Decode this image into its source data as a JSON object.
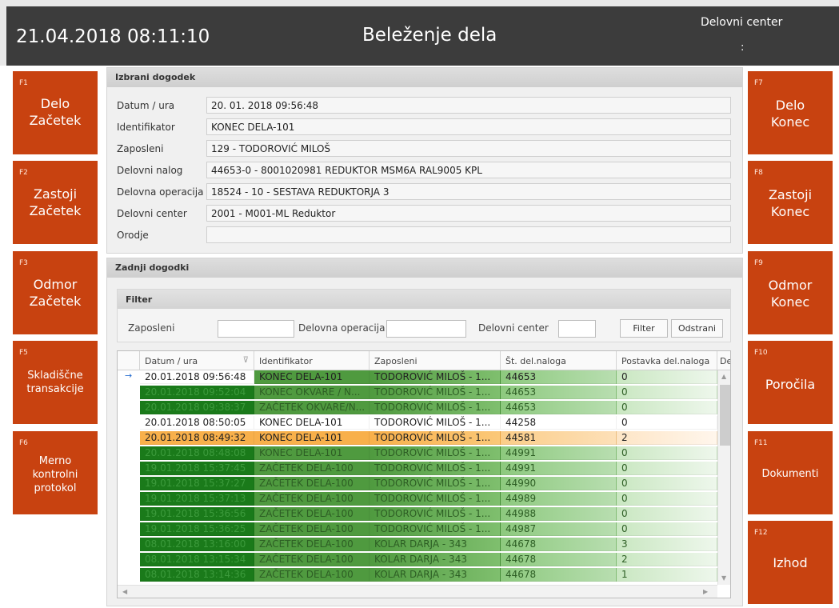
{
  "header": {
    "datetime": "21.04.2018 08:11:10",
    "title": "Beleženje dela",
    "work_center_label": "Delovni center",
    "work_center_value": ":"
  },
  "left_buttons": [
    {
      "key": "F1",
      "label": "Delo\nZačetek",
      "size": "big"
    },
    {
      "key": "F2",
      "label": "Zastoji\nZačetek",
      "size": "big"
    },
    {
      "key": "F3",
      "label": "Odmor\nZačetek",
      "size": "big"
    },
    {
      "key": "F5",
      "label": "Skladiščne\ntransakcije",
      "size": "small"
    },
    {
      "key": "F6",
      "label": "Merno\nkontrolni\nprotokol",
      "size": "small"
    }
  ],
  "right_buttons": [
    {
      "key": "F7",
      "label": "Delo\nKonec",
      "size": "big"
    },
    {
      "key": "F8",
      "label": "Zastoji\nKonec",
      "size": "big"
    },
    {
      "key": "F9",
      "label": "Odmor\nKonec",
      "size": "big"
    },
    {
      "key": "F10",
      "label": "Poročila",
      "size": "big"
    },
    {
      "key": "F11",
      "label": "Dokumenti",
      "size": "small"
    },
    {
      "key": "F12",
      "label": "Izhod",
      "size": "big"
    }
  ],
  "selected_event": {
    "title": "Izbrani dogodek",
    "fields": [
      {
        "label": "Datum / ura",
        "value": "20. 01. 2018 09:56:48"
      },
      {
        "label": "Identifikator",
        "value": "KONEC DELA-101"
      },
      {
        "label": "Zaposleni",
        "value": "129 - TODOROVIĆ MILOŠ"
      },
      {
        "label": "Delovni nalog",
        "value": "44653-0 - 8001020981 REDUKTOR MSM6A RAL9005 KPL"
      },
      {
        "label": "Delovna operacija",
        "value": "18524 - 10 - SESTAVA REDUKTORJA 3"
      },
      {
        "label": "Delovni center",
        "value": "2001 - M001-ML Reduktor"
      },
      {
        "label": "Orodje",
        "value": ""
      }
    ]
  },
  "recent_events": {
    "title": "Zadnji dogodki",
    "filter": {
      "title": "Filter",
      "employee_label": "Zaposleni",
      "operation_label": "Delovna operacija",
      "center_label": "Delovni center",
      "filter_button": "Filter",
      "clear_button": "Odstrani"
    },
    "columns": [
      "Datum / ura",
      "Identifikator",
      "Zaposleni",
      "Št. del.naloga",
      "Postavka del.naloga",
      "De"
    ],
    "row_marker": "→",
    "rows": [
      {
        "date": "20.01.2018 09:56:48",
        "id": "KONEC DELA-101",
        "emp": "TODOROVIĆ MILOŠ - 1...",
        "order": "44653",
        "item": "0",
        "style": "sel"
      },
      {
        "date": "20.01.2018 09:52:04",
        "id": "KONEC OKVARE / N...",
        "emp": "TODOROVIĆ MILOŠ - 1...",
        "order": "44653",
        "item": "0",
        "style": "green"
      },
      {
        "date": "20.01.2018 09:38:37",
        "id": "ZAČETEK OKVARE/N...",
        "emp": "TODOROVIĆ MILOŠ - 1...",
        "order": "44653",
        "item": "0",
        "style": "green"
      },
      {
        "date": "20.01.2018 08:50:05",
        "id": "KONEC DELA-101",
        "emp": "TODOROVIĆ MILOŠ - 1...",
        "order": "44258",
        "item": "0",
        "style": "white"
      },
      {
        "date": "20.01.2018 08:49:32",
        "id": "KONEC DELA-101",
        "emp": "TODOROVIĆ MILOŠ - 1...",
        "order": "44581",
        "item": "2",
        "style": "orange"
      },
      {
        "date": "20.01.2018 08:48:08",
        "id": "KONEC DELA-101",
        "emp": "TODOROVIĆ MILOŠ - 1...",
        "order": "44991",
        "item": "0",
        "style": "green"
      },
      {
        "date": "19.01.2018 15:37:45",
        "id": "ZAČETEK DELA-100",
        "emp": "TODOROVIĆ MILOŠ - 1...",
        "order": "44991",
        "item": "0",
        "style": "green"
      },
      {
        "date": "19.01.2018 15:37:27",
        "id": "ZAČETEK DELA-100",
        "emp": "TODOROVIĆ MILOŠ - 1...",
        "order": "44990",
        "item": "0",
        "style": "green"
      },
      {
        "date": "19.01.2018 15:37:13",
        "id": "ZAČETEK DELA-100",
        "emp": "TODOROVIĆ MILOŠ - 1...",
        "order": "44989",
        "item": "0",
        "style": "green"
      },
      {
        "date": "19.01.2018 15:36:56",
        "id": "ZAČETEK DELA-100",
        "emp": "TODOROVIĆ MILOŠ - 1...",
        "order": "44988",
        "item": "0",
        "style": "green"
      },
      {
        "date": "19.01.2018 15:36:25",
        "id": "ZAČETEK DELA-100",
        "emp": "TODOROVIĆ MILOŠ - 1...",
        "order": "44987",
        "item": "0",
        "style": "green"
      },
      {
        "date": "08.01.2018 13:16:00",
        "id": "ZAČETEK DELA-100",
        "emp": "KOLAR DARJA - 343",
        "order": "44678",
        "item": "3",
        "style": "green"
      },
      {
        "date": "08.01.2018 13:15:34",
        "id": "ZAČETEK DELA-100",
        "emp": "KOLAR DARJA - 343",
        "order": "44678",
        "item": "2",
        "style": "green"
      },
      {
        "date": "08.01.2018 13:14:36",
        "id": "ZAČETEK DELA-100",
        "emp": "KOLAR DARJA - 343",
        "order": "44678",
        "item": "1",
        "style": "green"
      }
    ]
  },
  "colors": {
    "accent_orange": "#c84210",
    "header_dark": "#3c3c3c",
    "row_green": "#4f9a3f",
    "row_orange": "#f8b04b"
  }
}
